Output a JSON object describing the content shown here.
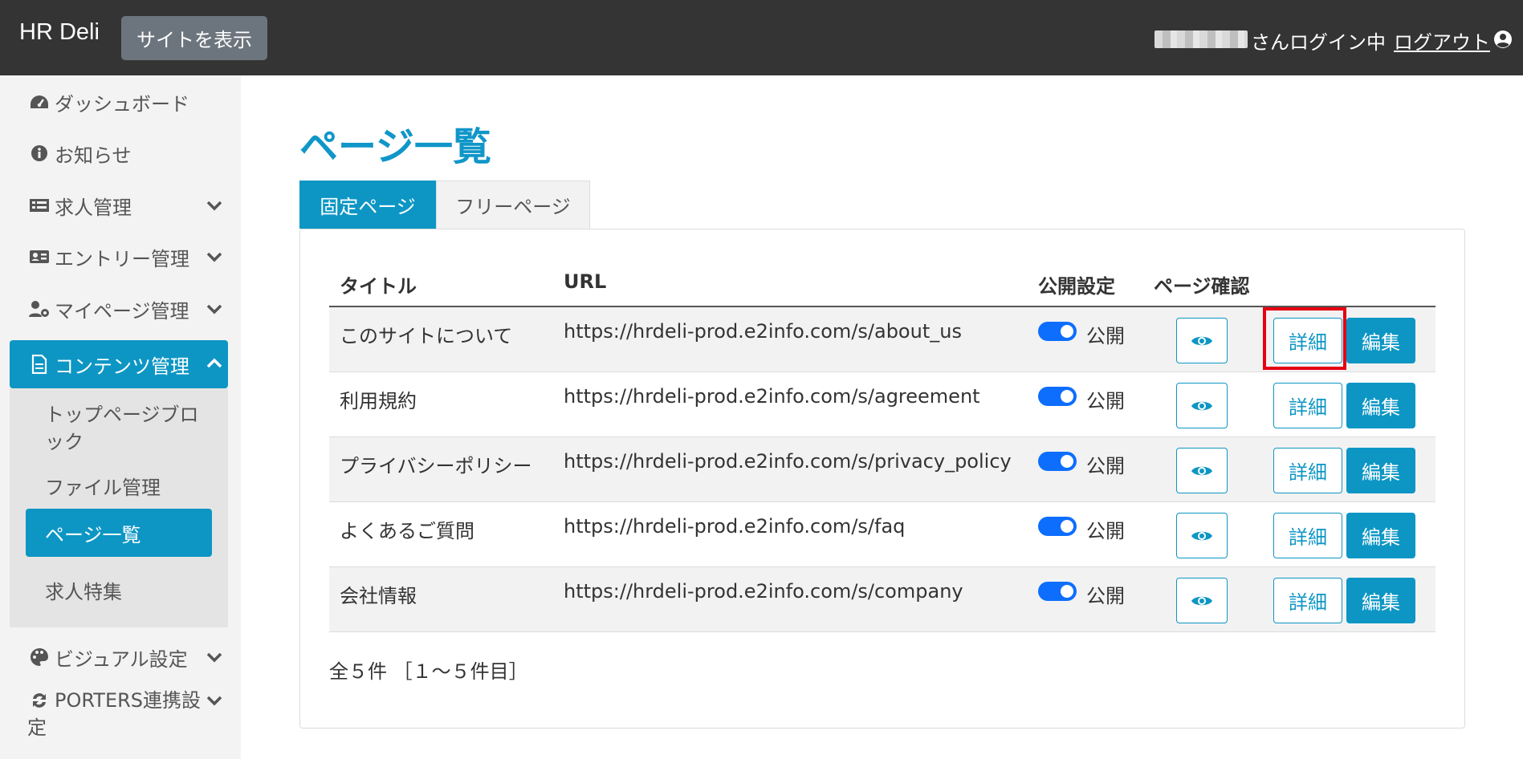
{
  "header": {
    "brand": "HR Deli",
    "view_site_label": "サイトを表示",
    "user_suffix": "さんログイン中",
    "logout_label": "ログアウト"
  },
  "sidebar": {
    "items": [
      {
        "label": "ダッシュボード",
        "icon": "dashboard-icon"
      },
      {
        "label": "お知らせ",
        "icon": "info-icon"
      },
      {
        "label": "求人管理",
        "icon": "job-list-icon"
      },
      {
        "label": "エントリー管理",
        "icon": "id-card-icon"
      },
      {
        "label": "マイページ管理",
        "icon": "user-gear-icon"
      },
      {
        "label": "コンテンツ管理",
        "icon": "document-icon"
      },
      {
        "label": "ビジュアル設定",
        "icon": "palette-icon"
      },
      {
        "label": "PORTERS連携設定",
        "icon": "sync-icon"
      }
    ],
    "content_sub": [
      {
        "label": "トップページブロック"
      },
      {
        "label": "ファイル管理"
      },
      {
        "label": "ページ一覧"
      },
      {
        "label": "求人特集"
      }
    ],
    "porters_line1": "PORTERS連携設",
    "porters_line2": "定",
    "top_block_line1": "トップページブロ",
    "top_block_line2": "ック"
  },
  "main": {
    "title": "ページ一覧",
    "tabs": [
      {
        "label": "固定ページ",
        "active": true
      },
      {
        "label": "フリーページ",
        "active": false
      }
    ],
    "table": {
      "headers": [
        "タイトル",
        "URL",
        "公開設定",
        "ページ確認"
      ],
      "rows": [
        {
          "title": "このサイトについて",
          "url": "https://hrdeli-prod.e2info.com/s/about_us",
          "status": "公開"
        },
        {
          "title": "利用規約",
          "url": "https://hrdeli-prod.e2info.com/s/agreement",
          "status": "公開"
        },
        {
          "title": "プライバシーポリシー",
          "url": "https://hrdeli-prod.e2info.com/s/privacy_policy",
          "status": "公開"
        },
        {
          "title": "よくあるご質問",
          "url": "https://hrdeli-prod.e2info.com/s/faq",
          "status": "公開"
        },
        {
          "title": "会社情報",
          "url": "https://hrdeli-prod.e2info.com/s/company",
          "status": "公開"
        }
      ],
      "detail_label": "詳細",
      "edit_label": "編集"
    },
    "count_text": "全５件 ［１〜５件目］"
  },
  "colors": {
    "accent": "#0d96c4",
    "header_bg": "#343434",
    "toggle_on": "#0d6efd",
    "highlight": "#e60012"
  }
}
